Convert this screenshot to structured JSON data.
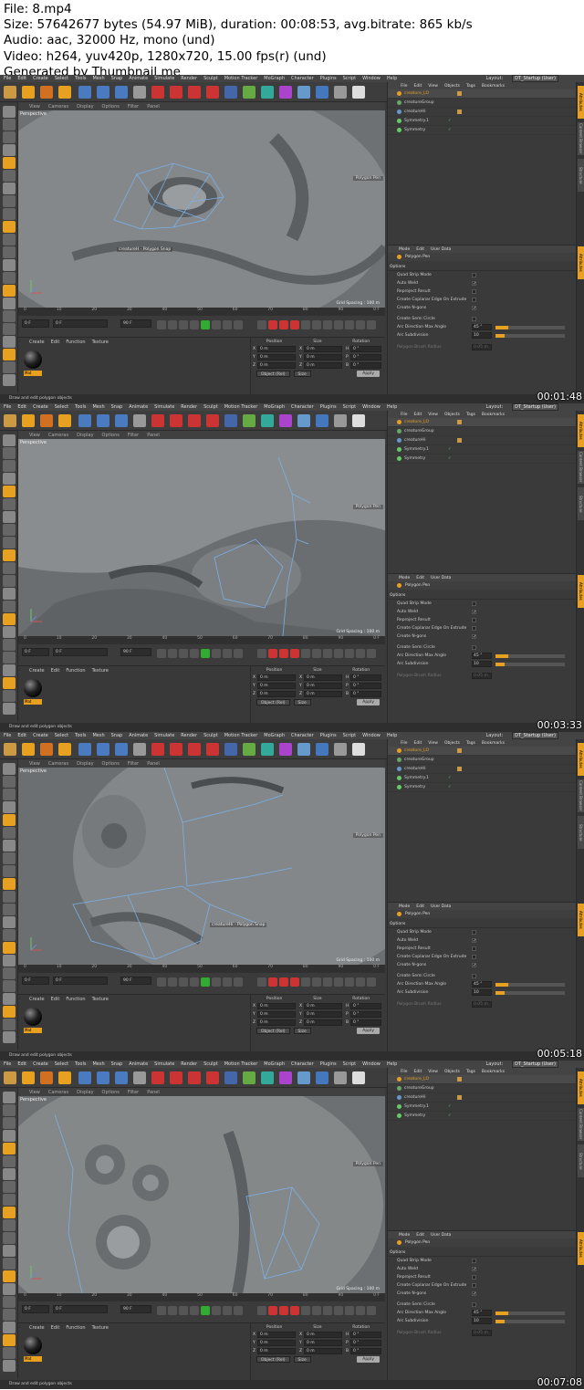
{
  "header": {
    "file": "File: 8.mp4",
    "size": "Size: 57642677 bytes (54.97 MiB), duration: 00:08:53, avg.bitrate: 865 kb/s",
    "audio": "Audio: aac, 32000 Hz, mono (und)",
    "video": "Video: h264, yuv420p, 1280x720, 15.00 fps(r) (und)",
    "generated": "Generated by Thumbnail me"
  },
  "menu": [
    "File",
    "Edit",
    "Create",
    "Select",
    "Tools",
    "Mesh",
    "Snap",
    "Animate",
    "Simulate",
    "Render",
    "Sculpt",
    "Motion Tracker",
    "MoGraph",
    "Character",
    "Plugins",
    "Script",
    "Window",
    "Help"
  ],
  "layout_label": "Layout:",
  "layout_value": "DT_Startup (User)",
  "viewport_menu": [
    "View",
    "Cameras",
    "Display",
    "Options",
    "Filter",
    "Panel"
  ],
  "viewport_label": "Perspective",
  "grid_spacing": "Grid Spacing : 100 m",
  "polygon_pen_hud": "Polygon Pen",
  "timeline_ticks": [
    "0",
    "10",
    "20",
    "30",
    "40",
    "50",
    "60",
    "70",
    "80",
    "90",
    "0 F"
  ],
  "frame_start": "0 F",
  "frame_end": "90 F",
  "material_menu": [
    "Create",
    "Edit",
    "Function",
    "Texture"
  ],
  "material_name": "Mat",
  "coord_headers": [
    "Position",
    "Size",
    "Rotation"
  ],
  "coord_rows": [
    {
      "axis": "X",
      "pos": "0 m",
      "size": "0 m",
      "rot_axis": "H",
      "rot": "0 °"
    },
    {
      "axis": "Y",
      "pos": "0 m",
      "size": "0 m",
      "rot_axis": "P",
      "rot": "0 °"
    },
    {
      "axis": "Z",
      "pos": "0 m",
      "size": "0 m",
      "rot_axis": "B",
      "rot": "0 °"
    }
  ],
  "coord_mode": "Object (Rel)",
  "coord_size": "Size",
  "apply": "Apply",
  "status": "Draw and edit polygon objects",
  "object_menu": [
    "File",
    "Edit",
    "View",
    "Objects",
    "Tags",
    "Bookmarks"
  ],
  "objects": [
    {
      "name": "creature_LO",
      "selected": true
    },
    {
      "name": "creatureGroup",
      "selected": false
    },
    {
      "name": "creatureHi",
      "selected": false
    },
    {
      "name": "Symmetry.1",
      "selected": false
    },
    {
      "name": "Symmetry",
      "selected": false
    }
  ],
  "attr_menu": [
    "Mode",
    "Edit",
    "User Data"
  ],
  "attr_title": "Polygon Pen",
  "options_label": "Options",
  "attr_rows": [
    {
      "label": "Quad Strip Mode",
      "checked": false
    },
    {
      "label": "Auto Weld",
      "checked": true
    },
    {
      "label": "Reproject Result",
      "checked": false
    },
    {
      "label": "Create Coplanar Edge On Extrude",
      "checked": false
    },
    {
      "label": "Create N-gons",
      "checked": true
    }
  ],
  "semi_circle": "Create Semi Circle",
  "arc_angle_label": "Arc Direction Max Angle",
  "arc_angle_value": "45 °",
  "arc_sub_label": "Arc Subdivision",
  "arc_sub_value": "10",
  "brush_radius_label": "Polygon Brush Radius",
  "brush_radius_value": "0.05 m",
  "vtabs": [
    "Attributes",
    "Content Browser",
    "Structure"
  ],
  "snap_labels": [
    "creatureH - Polygon Snap",
    "",
    "creatureHi - Polygon Snap",
    ""
  ],
  "timestamps": [
    "00:01:48",
    "00:03:33",
    "00:05:18",
    "00:07:08"
  ],
  "colors": {
    "accent": "#e8a020",
    "ui_bg": "#3a3a3a",
    "mesh": "#7ab0e8"
  }
}
